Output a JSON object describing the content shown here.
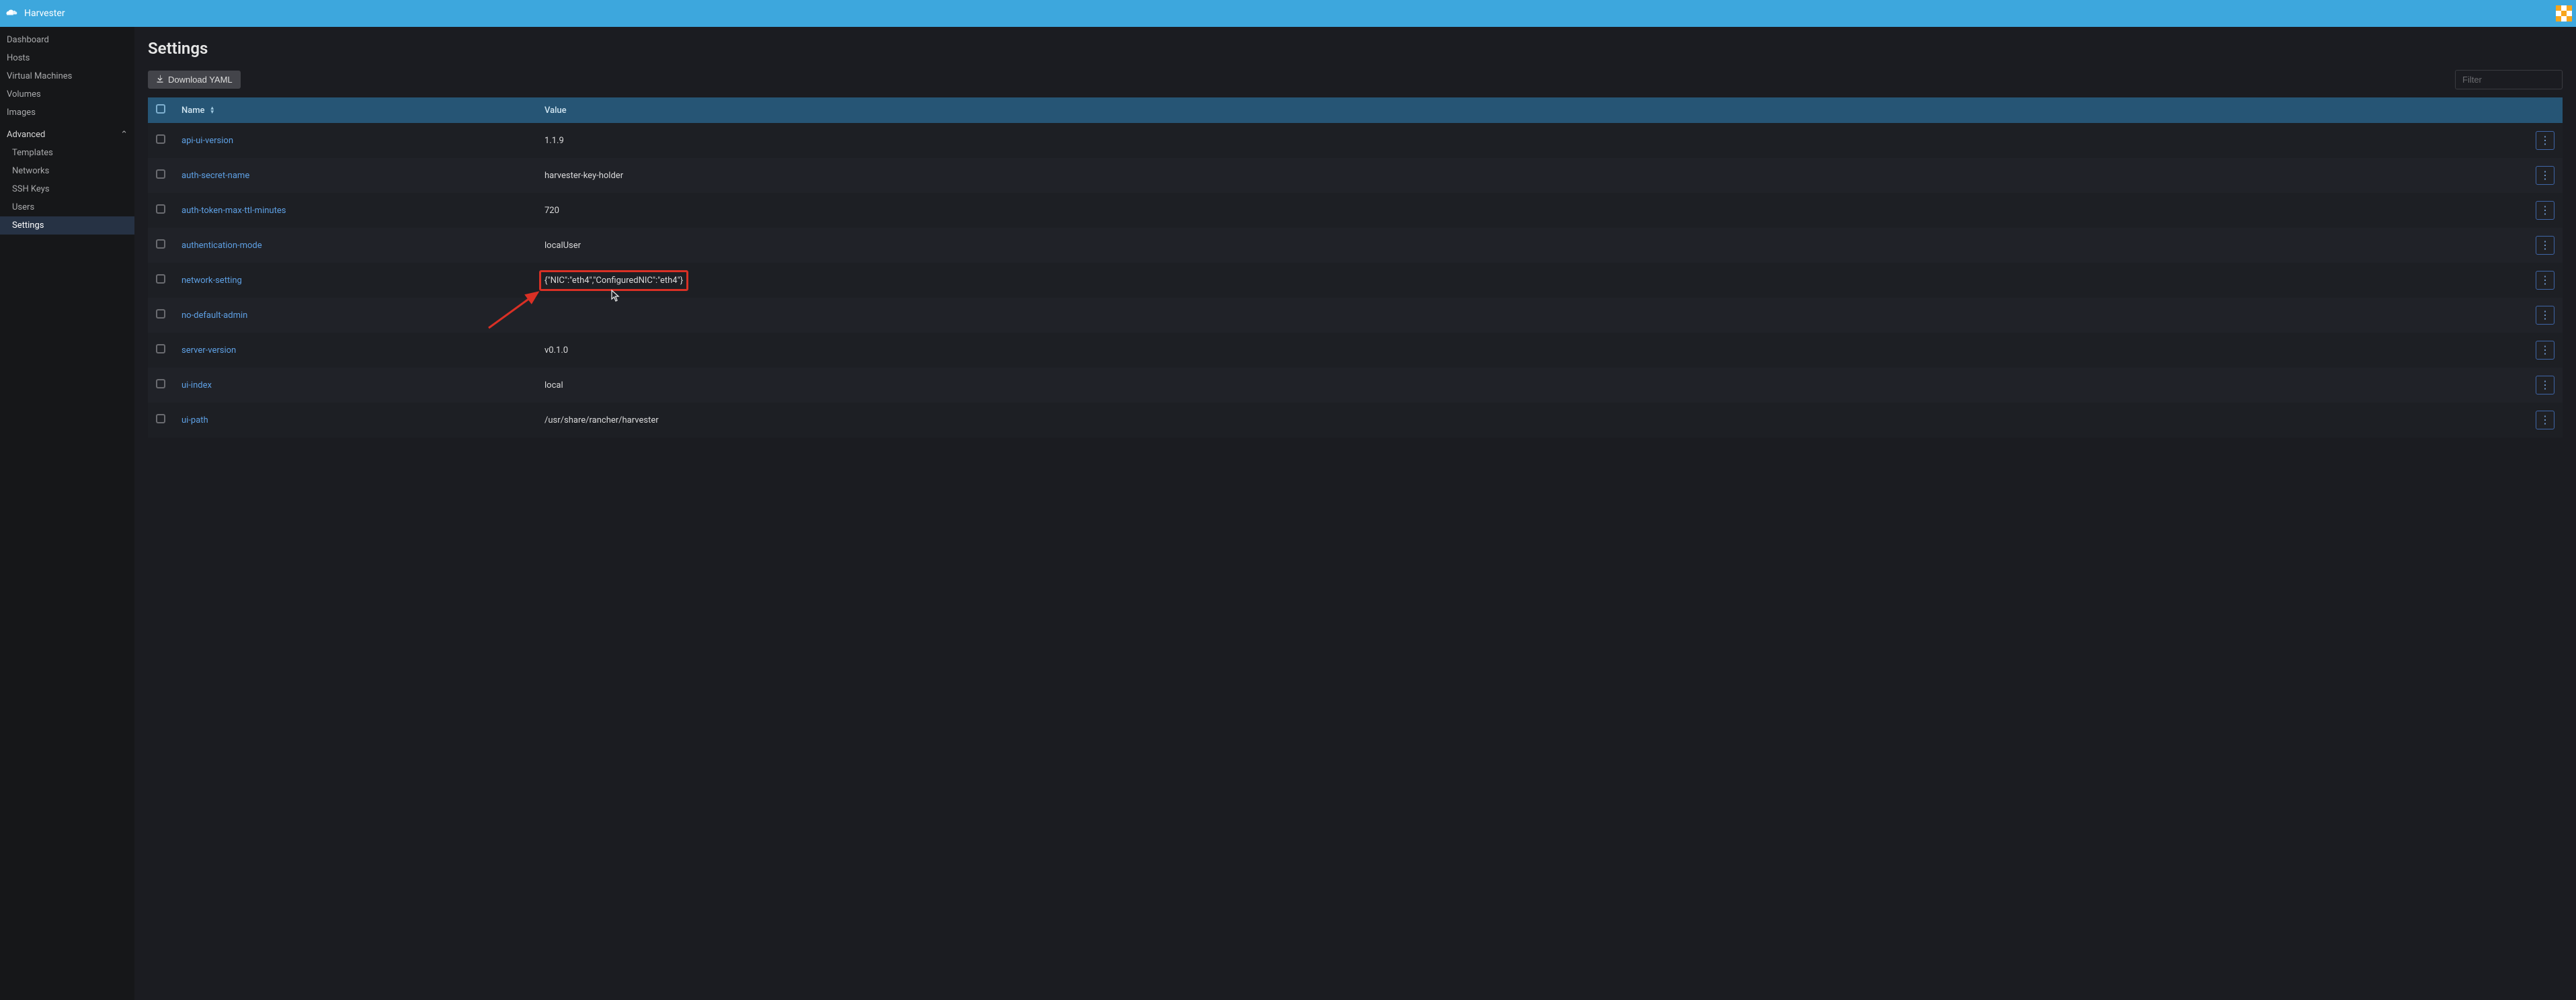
{
  "brand": {
    "name": "Harvester"
  },
  "sidebar": {
    "items": [
      {
        "label": "Dashboard"
      },
      {
        "label": "Hosts"
      },
      {
        "label": "Virtual Machines"
      },
      {
        "label": "Volumes"
      },
      {
        "label": "Images"
      }
    ],
    "advanced_label": "Advanced",
    "advanced_items": [
      {
        "label": "Templates"
      },
      {
        "label": "Networks"
      },
      {
        "label": "SSH Keys"
      },
      {
        "label": "Users"
      },
      {
        "label": "Settings",
        "active": true
      }
    ]
  },
  "page": {
    "title": "Settings",
    "download_label": "Download YAML",
    "filter_placeholder": "Filter"
  },
  "table": {
    "headers": {
      "name": "Name",
      "value": "Value"
    },
    "rows": [
      {
        "name": "api-ui-version",
        "value": "1.1.9"
      },
      {
        "name": "auth-secret-name",
        "value": "harvester-key-holder"
      },
      {
        "name": "auth-token-max-ttl-minutes",
        "value": "720"
      },
      {
        "name": "authentication-mode",
        "value": "localUser"
      },
      {
        "name": "network-setting",
        "value": "{\"NIC\":\"eth4\",\"ConfiguredNIC\":\"eth4\"}"
      },
      {
        "name": "no-default-admin",
        "value": ""
      },
      {
        "name": "server-version",
        "value": "v0.1.0"
      },
      {
        "name": "ui-index",
        "value": "local"
      },
      {
        "name": "ui-path",
        "value": "/usr/share/rancher/harvester"
      }
    ]
  }
}
